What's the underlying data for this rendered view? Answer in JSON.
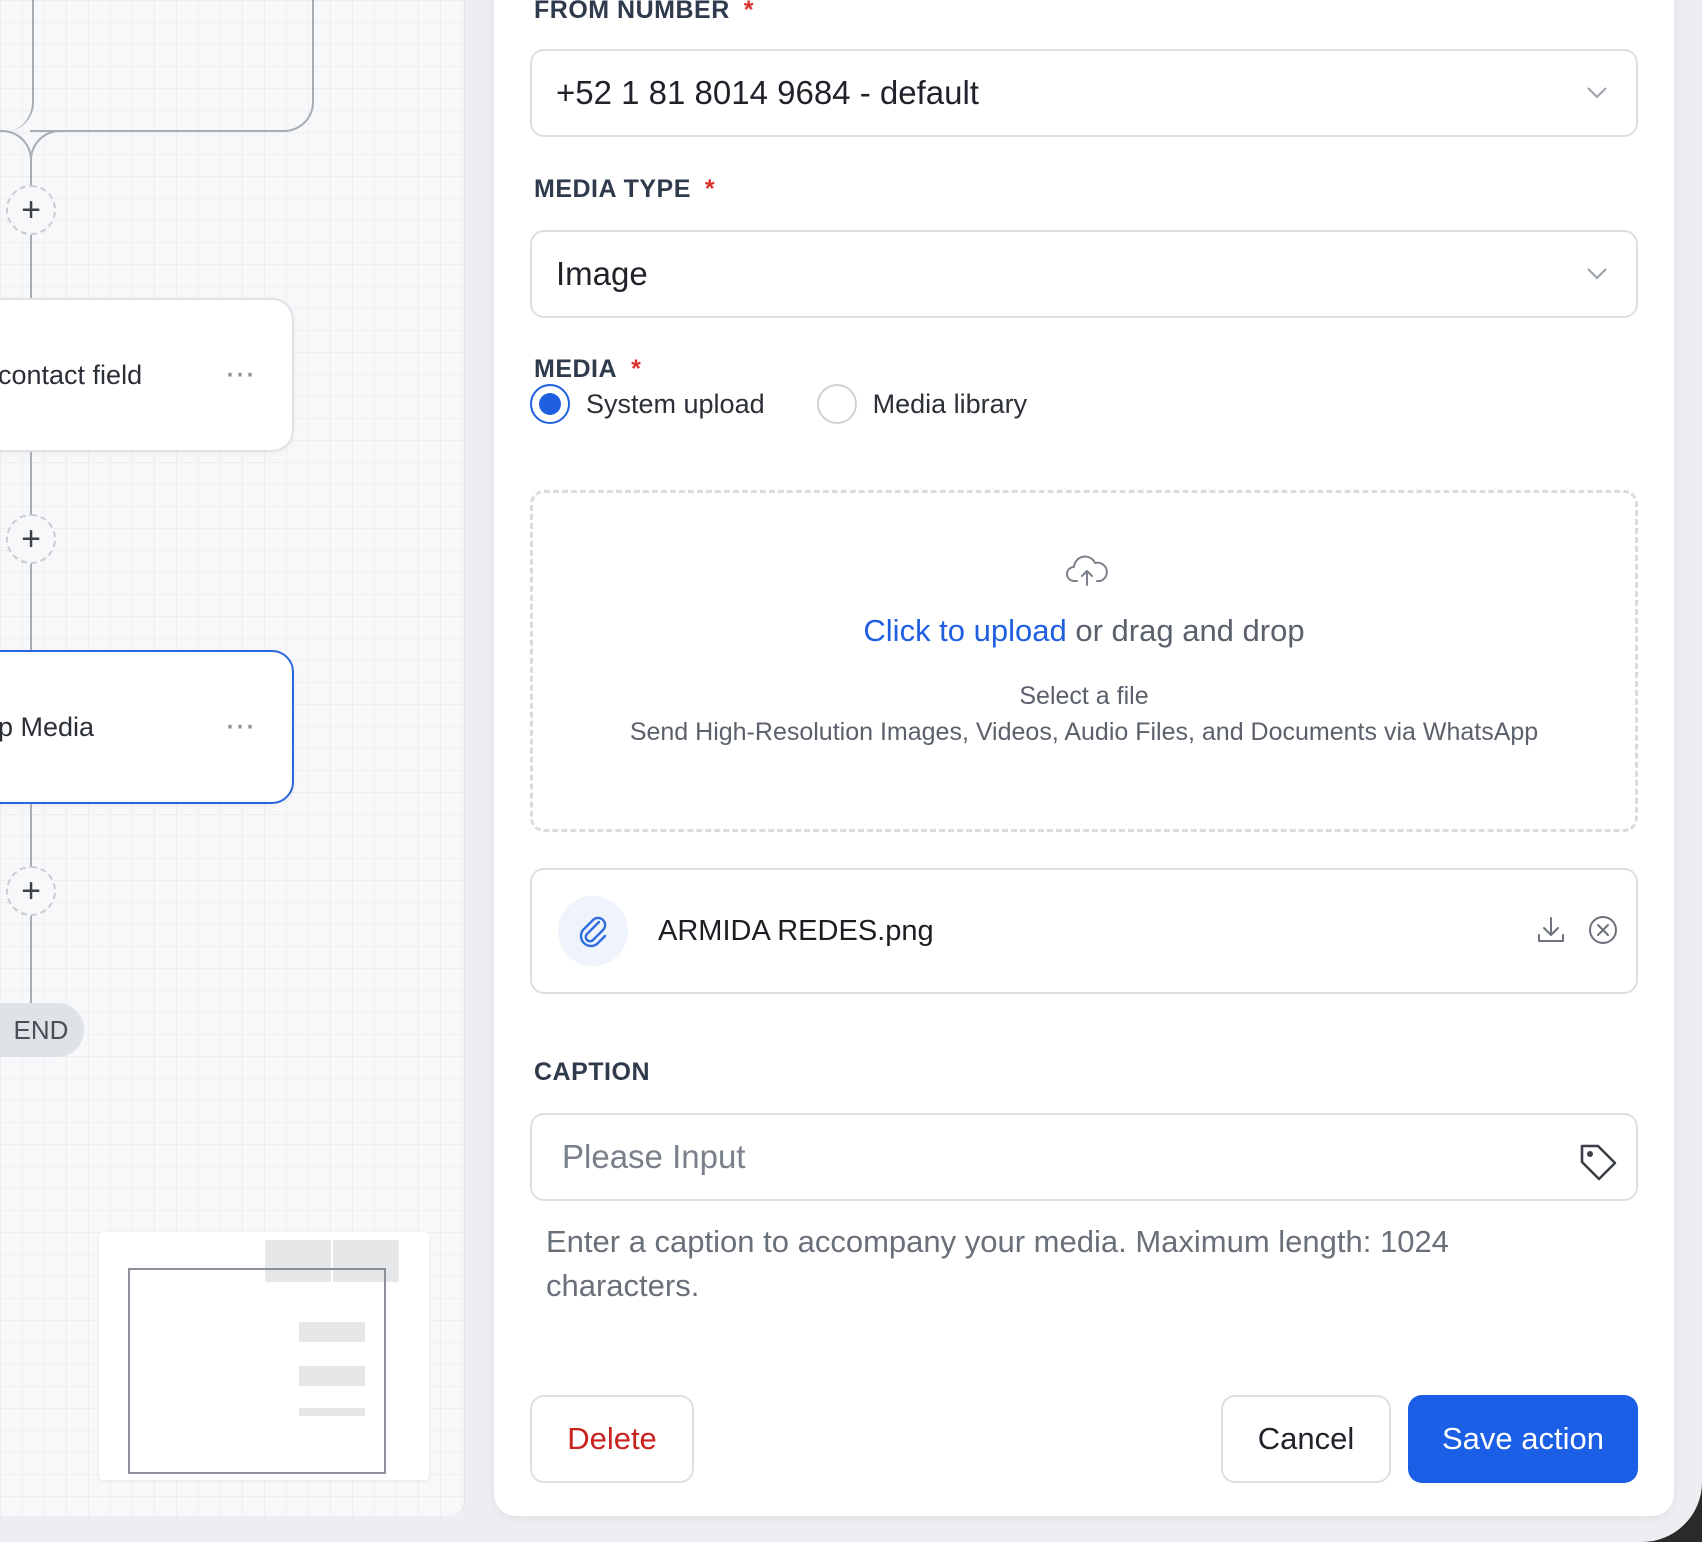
{
  "canvas": {
    "nodes": [
      {
        "label": "contact field",
        "menu": "⋯",
        "active": false
      },
      {
        "label": "p Media",
        "menu": "⋯",
        "active": true
      }
    ],
    "add_step_symbol": "+",
    "end_label": "END"
  },
  "panel": {
    "from_number": {
      "label": "FROM NUMBER",
      "required": "*",
      "value": "+52 1 81 8014 9684 - default"
    },
    "media_type": {
      "label": "MEDIA TYPE",
      "required": "*",
      "value": "Image"
    },
    "media": {
      "label": "MEDIA",
      "required": "*",
      "options": [
        {
          "label": "System upload",
          "selected": true
        },
        {
          "label": "Media library",
          "selected": false
        }
      ],
      "dropzone": {
        "link_text": "Click to upload",
        "rest_text": " or drag and drop",
        "line1": "Select a file",
        "line2": "Send High-Resolution Images, Videos, Audio Files, and Documents via WhatsApp"
      },
      "file": {
        "name": "ARMIDA REDES.png"
      }
    },
    "caption": {
      "label": "CAPTION",
      "placeholder": "Please Input",
      "value": "",
      "help": "Enter a caption to accompany your media. Maximum length: 1024 characters."
    },
    "buttons": {
      "delete": "Delete",
      "cancel": "Cancel",
      "save": "Save action"
    }
  },
  "colors": {
    "primary": "#1a5fe6",
    "danger": "#c8231f",
    "required": "#d9302b"
  },
  "icons": [
    "chevron-down-icon",
    "upload-cloud-icon",
    "paperclip-icon",
    "download-icon",
    "remove-circle-icon",
    "tag-icon",
    "more-dots-icon",
    "plus-icon"
  ]
}
